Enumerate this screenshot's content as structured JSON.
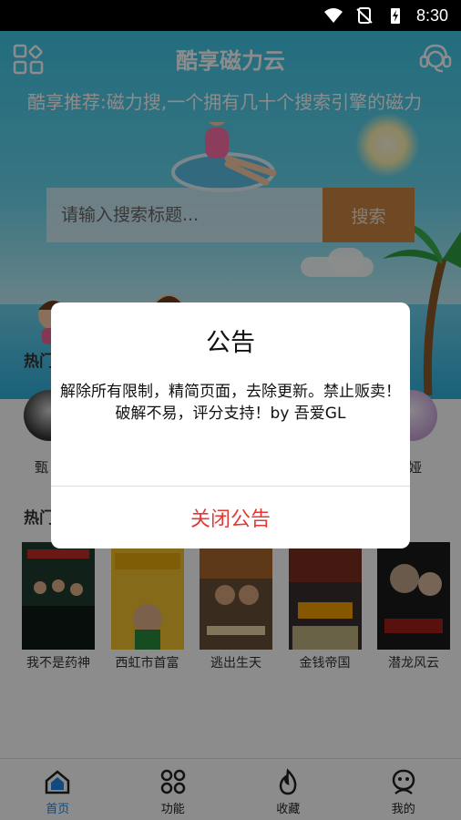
{
  "status_bar": {
    "time": "8:30"
  },
  "header": {
    "title": "酷享磁力云"
  },
  "announcement_scroll": "酷享推荐:磁力搜,一个拥有几十个搜索引擎的磁力",
  "search": {
    "placeholder": "请输入搜索标题...",
    "button_label": "搜索"
  },
  "sections": {
    "hot_people_title": "热门",
    "hot_movies_title": "热门"
  },
  "hot_people": [
    {
      "name": "甄"
    },
    {
      "name": "娅"
    }
  ],
  "hot_movies": [
    {
      "title": "我不是药神"
    },
    {
      "title": "西虹市首富"
    },
    {
      "title": "逃出生天"
    },
    {
      "title": "金钱帝国"
    },
    {
      "title": "潜龙风云"
    }
  ],
  "bottom_nav": [
    {
      "label": "首页",
      "icon": "home-icon",
      "active": true
    },
    {
      "label": "功能",
      "icon": "grid-icon",
      "active": false
    },
    {
      "label": "收藏",
      "icon": "flame-icon",
      "active": false
    },
    {
      "label": "我的",
      "icon": "profile-icon",
      "active": false
    }
  ],
  "dialog": {
    "title": "公告",
    "body": "解除所有限制，精简页面，去除更新。禁止贩卖！破解不易，评分支持！by 吾爱GL",
    "close_label": "关闭公告"
  },
  "colors": {
    "accent": "#1e88e5",
    "search_button": "#c88642",
    "close_text": "#e53935"
  }
}
